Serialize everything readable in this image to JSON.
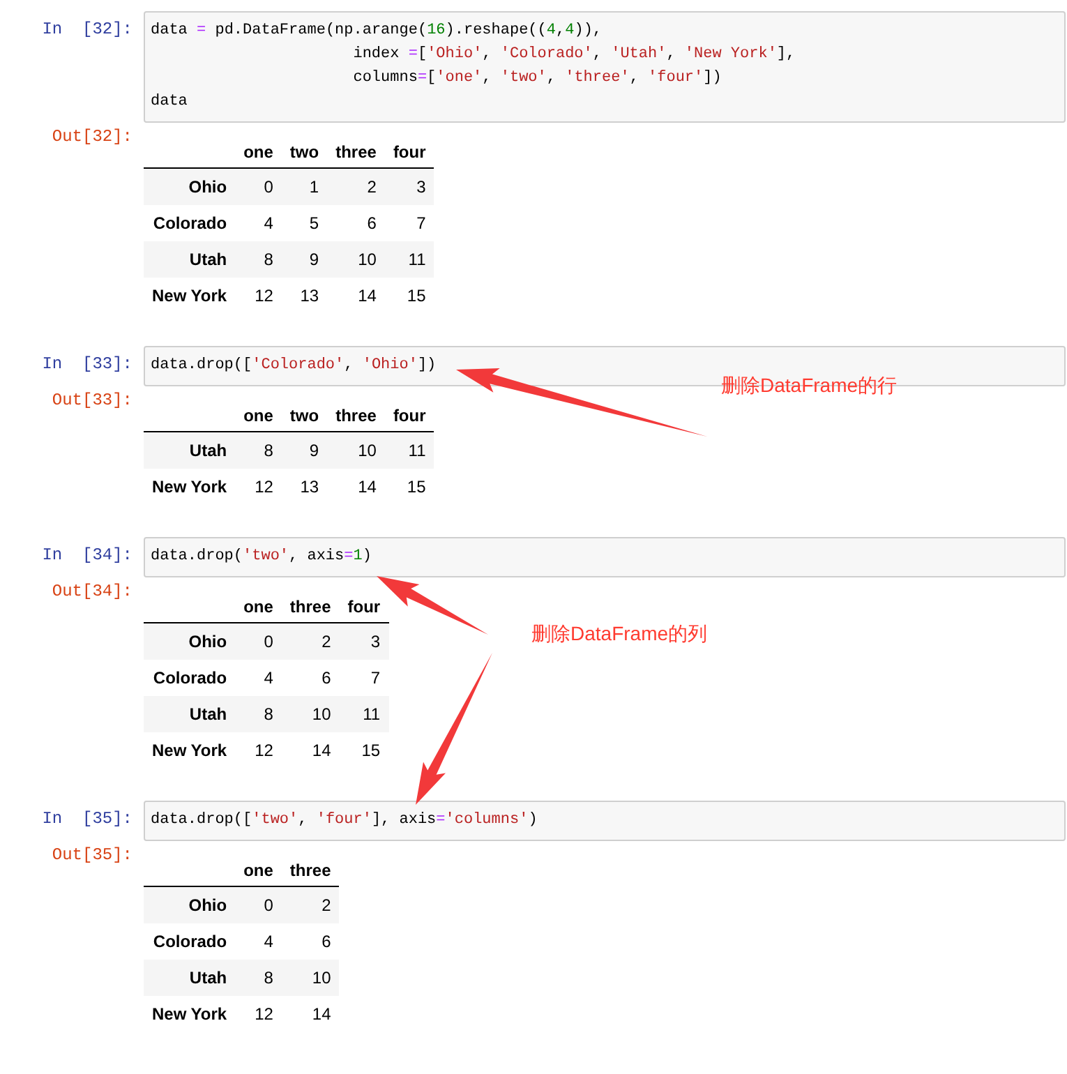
{
  "cells": [
    {
      "prompt_in": "In  [32]:",
      "code": [
        [
          {
            "kind": "plain",
            "text": "data "
          },
          {
            "kind": "operator",
            "text": "="
          },
          {
            "kind": "plain",
            "text": " pd.DataFrame(np.arange("
          },
          {
            "kind": "number",
            "text": "16"
          },
          {
            "kind": "plain",
            "text": ").reshape(("
          },
          {
            "kind": "number",
            "text": "4"
          },
          {
            "kind": "plain",
            "text": ","
          },
          {
            "kind": "number",
            "text": "4"
          },
          {
            "kind": "plain",
            "text": ")),"
          }
        ],
        [
          {
            "kind": "plain",
            "text": "                      index "
          },
          {
            "kind": "operator",
            "text": "="
          },
          {
            "kind": "plain",
            "text": "["
          },
          {
            "kind": "string",
            "text": "'Ohio'"
          },
          {
            "kind": "plain",
            "text": ", "
          },
          {
            "kind": "string",
            "text": "'Colorado'"
          },
          {
            "kind": "plain",
            "text": ", "
          },
          {
            "kind": "string",
            "text": "'Utah'"
          },
          {
            "kind": "plain",
            "text": ", "
          },
          {
            "kind": "string",
            "text": "'New York'"
          },
          {
            "kind": "plain",
            "text": "],"
          }
        ],
        [
          {
            "kind": "plain",
            "text": "                      columns"
          },
          {
            "kind": "operator",
            "text": "="
          },
          {
            "kind": "plain",
            "text": "["
          },
          {
            "kind": "string",
            "text": "'one'"
          },
          {
            "kind": "plain",
            "text": ", "
          },
          {
            "kind": "string",
            "text": "'two'"
          },
          {
            "kind": "plain",
            "text": ", "
          },
          {
            "kind": "string",
            "text": "'three'"
          },
          {
            "kind": "plain",
            "text": ", "
          },
          {
            "kind": "string",
            "text": "'four'"
          },
          {
            "kind": "plain",
            "text": "])"
          }
        ],
        [
          {
            "kind": "plain",
            "text": "data"
          }
        ]
      ],
      "prompt_out": "Out[32]:",
      "table": {
        "columns": [
          "one",
          "two",
          "three",
          "four"
        ],
        "rows": [
          {
            "index": "Ohio",
            "values": [
              "0",
              "1",
              "2",
              "3"
            ]
          },
          {
            "index": "Colorado",
            "values": [
              "4",
              "5",
              "6",
              "7"
            ]
          },
          {
            "index": "Utah",
            "values": [
              "8",
              "9",
              "10",
              "11"
            ]
          },
          {
            "index": "New York",
            "values": [
              "12",
              "13",
              "14",
              "15"
            ]
          }
        ]
      }
    },
    {
      "prompt_in": "In  [33]:",
      "code": [
        [
          {
            "kind": "plain",
            "text": "data.drop(["
          },
          {
            "kind": "string",
            "text": "'Colorado'"
          },
          {
            "kind": "plain",
            "text": ", "
          },
          {
            "kind": "string",
            "text": "'Ohio'"
          },
          {
            "kind": "plain",
            "text": "])"
          }
        ]
      ],
      "prompt_out": "Out[33]:",
      "table": {
        "columns": [
          "one",
          "two",
          "three",
          "four"
        ],
        "rows": [
          {
            "index": "Utah",
            "values": [
              "8",
              "9",
              "10",
              "11"
            ]
          },
          {
            "index": "New York",
            "values": [
              "12",
              "13",
              "14",
              "15"
            ]
          }
        ]
      }
    },
    {
      "prompt_in": "In  [34]:",
      "code": [
        [
          {
            "kind": "plain",
            "text": "data.drop("
          },
          {
            "kind": "string",
            "text": "'two'"
          },
          {
            "kind": "plain",
            "text": ", axis"
          },
          {
            "kind": "operator",
            "text": "="
          },
          {
            "kind": "number",
            "text": "1"
          },
          {
            "kind": "plain",
            "text": ")"
          }
        ]
      ],
      "prompt_out": "Out[34]:",
      "table": {
        "columns": [
          "one",
          "three",
          "four"
        ],
        "rows": [
          {
            "index": "Ohio",
            "values": [
              "0",
              "2",
              "3"
            ]
          },
          {
            "index": "Colorado",
            "values": [
              "4",
              "6",
              "7"
            ]
          },
          {
            "index": "Utah",
            "values": [
              "8",
              "10",
              "11"
            ]
          },
          {
            "index": "New York",
            "values": [
              "12",
              "14",
              "15"
            ]
          }
        ]
      }
    },
    {
      "prompt_in": "In  [35]:",
      "code": [
        [
          {
            "kind": "plain",
            "text": "data.drop(["
          },
          {
            "kind": "string",
            "text": "'two'"
          },
          {
            "kind": "plain",
            "text": ", "
          },
          {
            "kind": "string",
            "text": "'four'"
          },
          {
            "kind": "plain",
            "text": "], axis"
          },
          {
            "kind": "operator",
            "text": "="
          },
          {
            "kind": "string",
            "text": "'columns'"
          },
          {
            "kind": "plain",
            "text": ")"
          }
        ]
      ],
      "prompt_out": "Out[35]:",
      "table": {
        "columns": [
          "one",
          "three"
        ],
        "rows": [
          {
            "index": "Ohio",
            "values": [
              "0",
              "2"
            ]
          },
          {
            "index": "Colorado",
            "values": [
              "4",
              "6"
            ]
          },
          {
            "index": "Utah",
            "values": [
              "8",
              "10"
            ]
          },
          {
            "index": "New York",
            "values": [
              "12",
              "14"
            ]
          }
        ]
      }
    }
  ],
  "annotations": [
    {
      "text": "删除DataFrame的行"
    },
    {
      "text": "删除DataFrame的列"
    }
  ]
}
